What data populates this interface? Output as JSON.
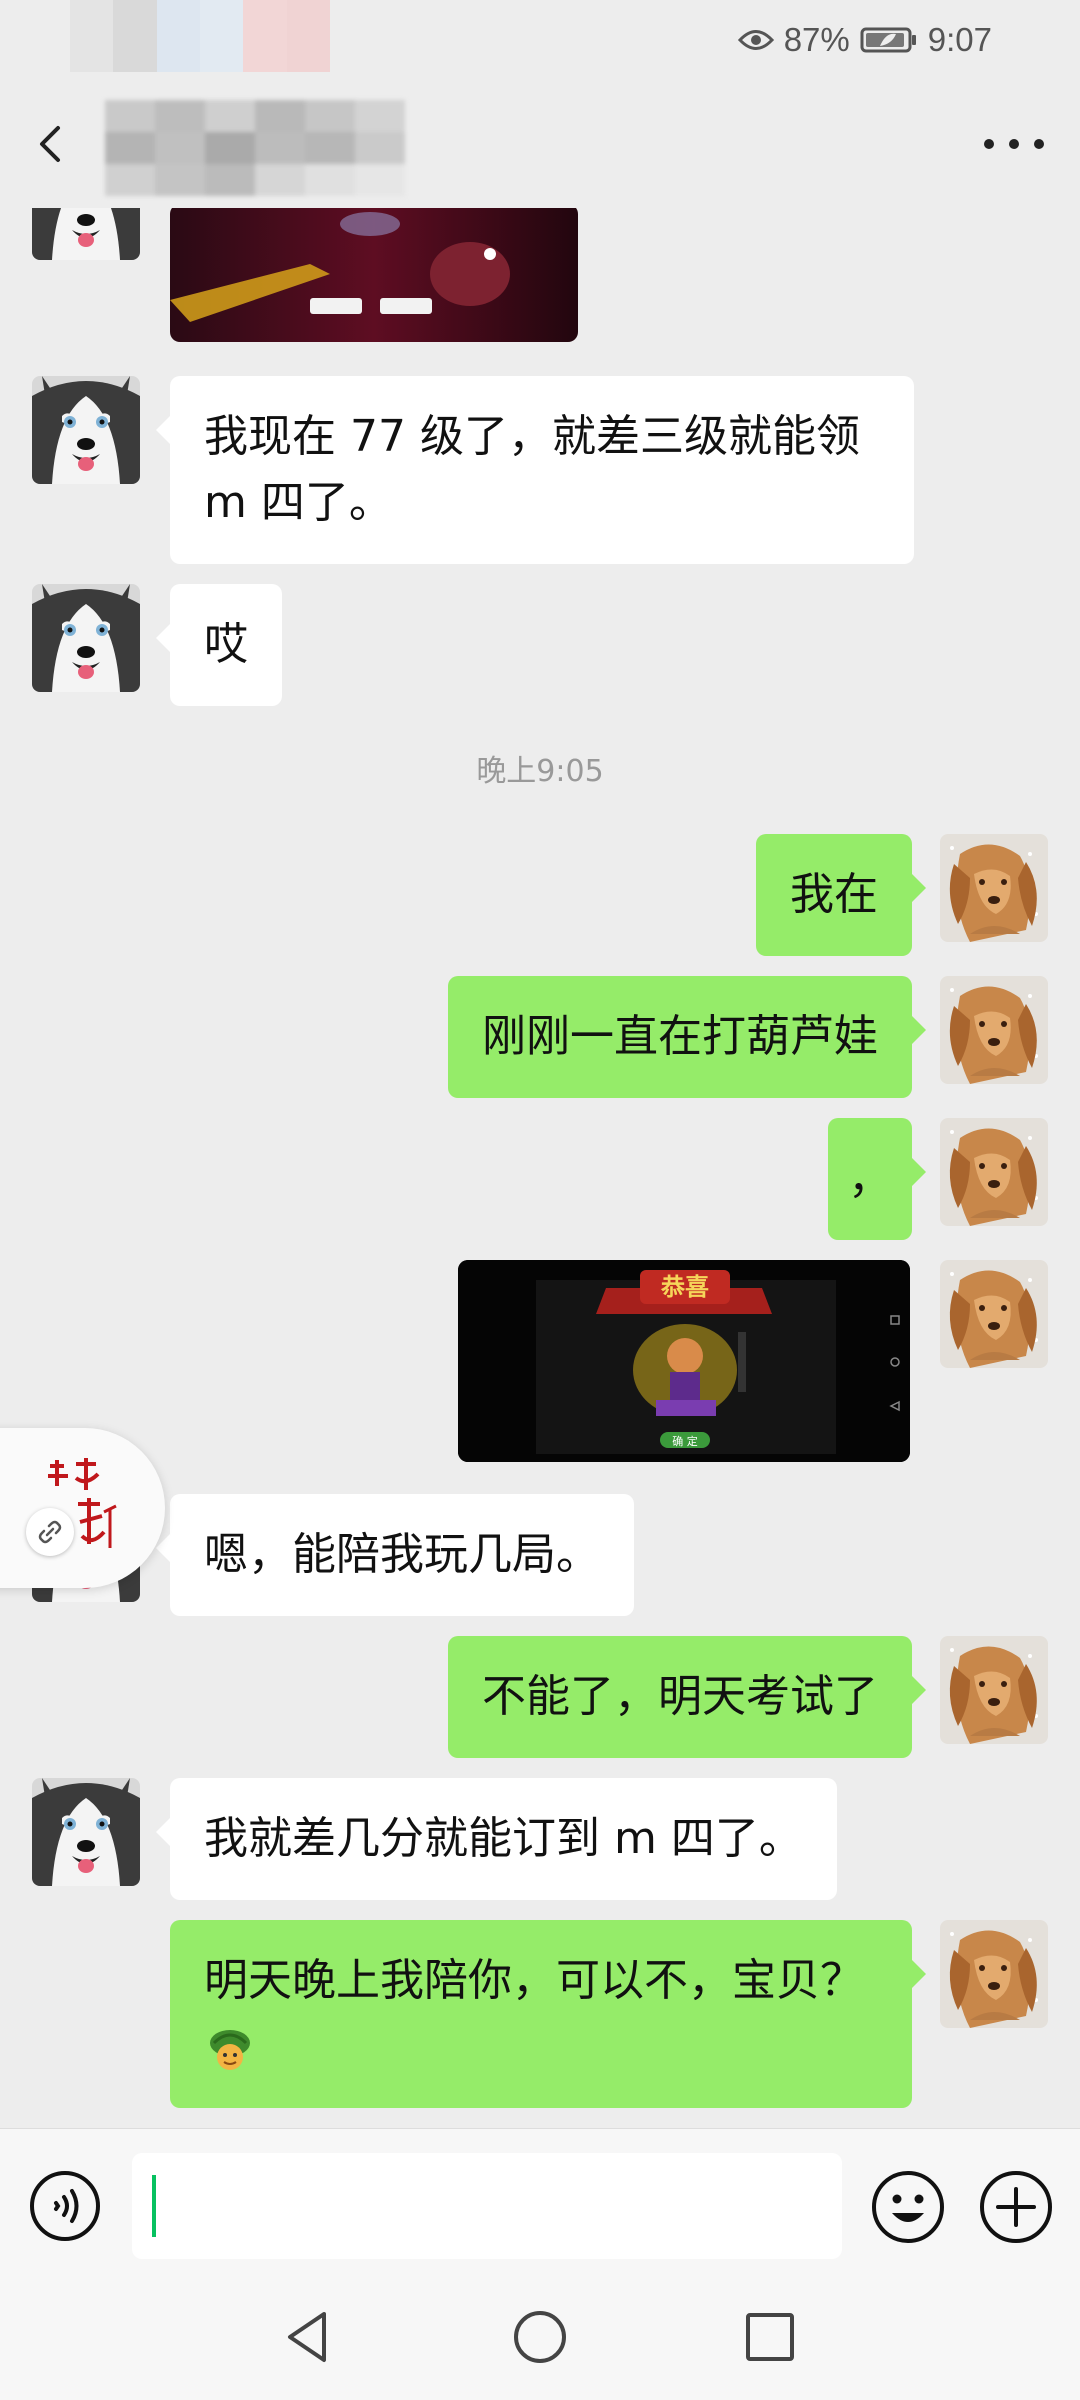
{
  "status_bar": {
    "battery_percent": "87%",
    "time": "9:07"
  },
  "header": {
    "back_icon": "back-arrow-icon",
    "more_icon": "more-dots-icon"
  },
  "messages": [
    {
      "side": "left",
      "type": "text",
      "text": "我现在 77 级了，就差三级就能领\nm 四了。"
    },
    {
      "side": "left",
      "type": "text",
      "text": "哎"
    },
    {
      "type": "timestamp",
      "text": "晚上9:05"
    },
    {
      "side": "right",
      "type": "text",
      "text": "我在"
    },
    {
      "side": "right",
      "type": "text",
      "text": "刚刚一直在打葫芦娃"
    },
    {
      "side": "right",
      "type": "text",
      "text": "，"
    },
    {
      "side": "left",
      "type": "text",
      "text": "嗯，能陪我玩几局。"
    },
    {
      "side": "right",
      "type": "text",
      "text": "不能了，明天考试了"
    },
    {
      "side": "left",
      "type": "text",
      "text": "我就差几分就能订到 m 四了。"
    },
    {
      "side": "right",
      "type": "text",
      "text": "明天晚上我陪你，可以不，宝贝？"
    }
  ],
  "game_image": {
    "title": "恭喜",
    "button": "确 定"
  },
  "input": {
    "placeholder": ""
  },
  "colors": {
    "background": "#ededed",
    "bubble_right": "#95ec69",
    "bubble_left": "#ffffff",
    "accent": "#07c160"
  }
}
